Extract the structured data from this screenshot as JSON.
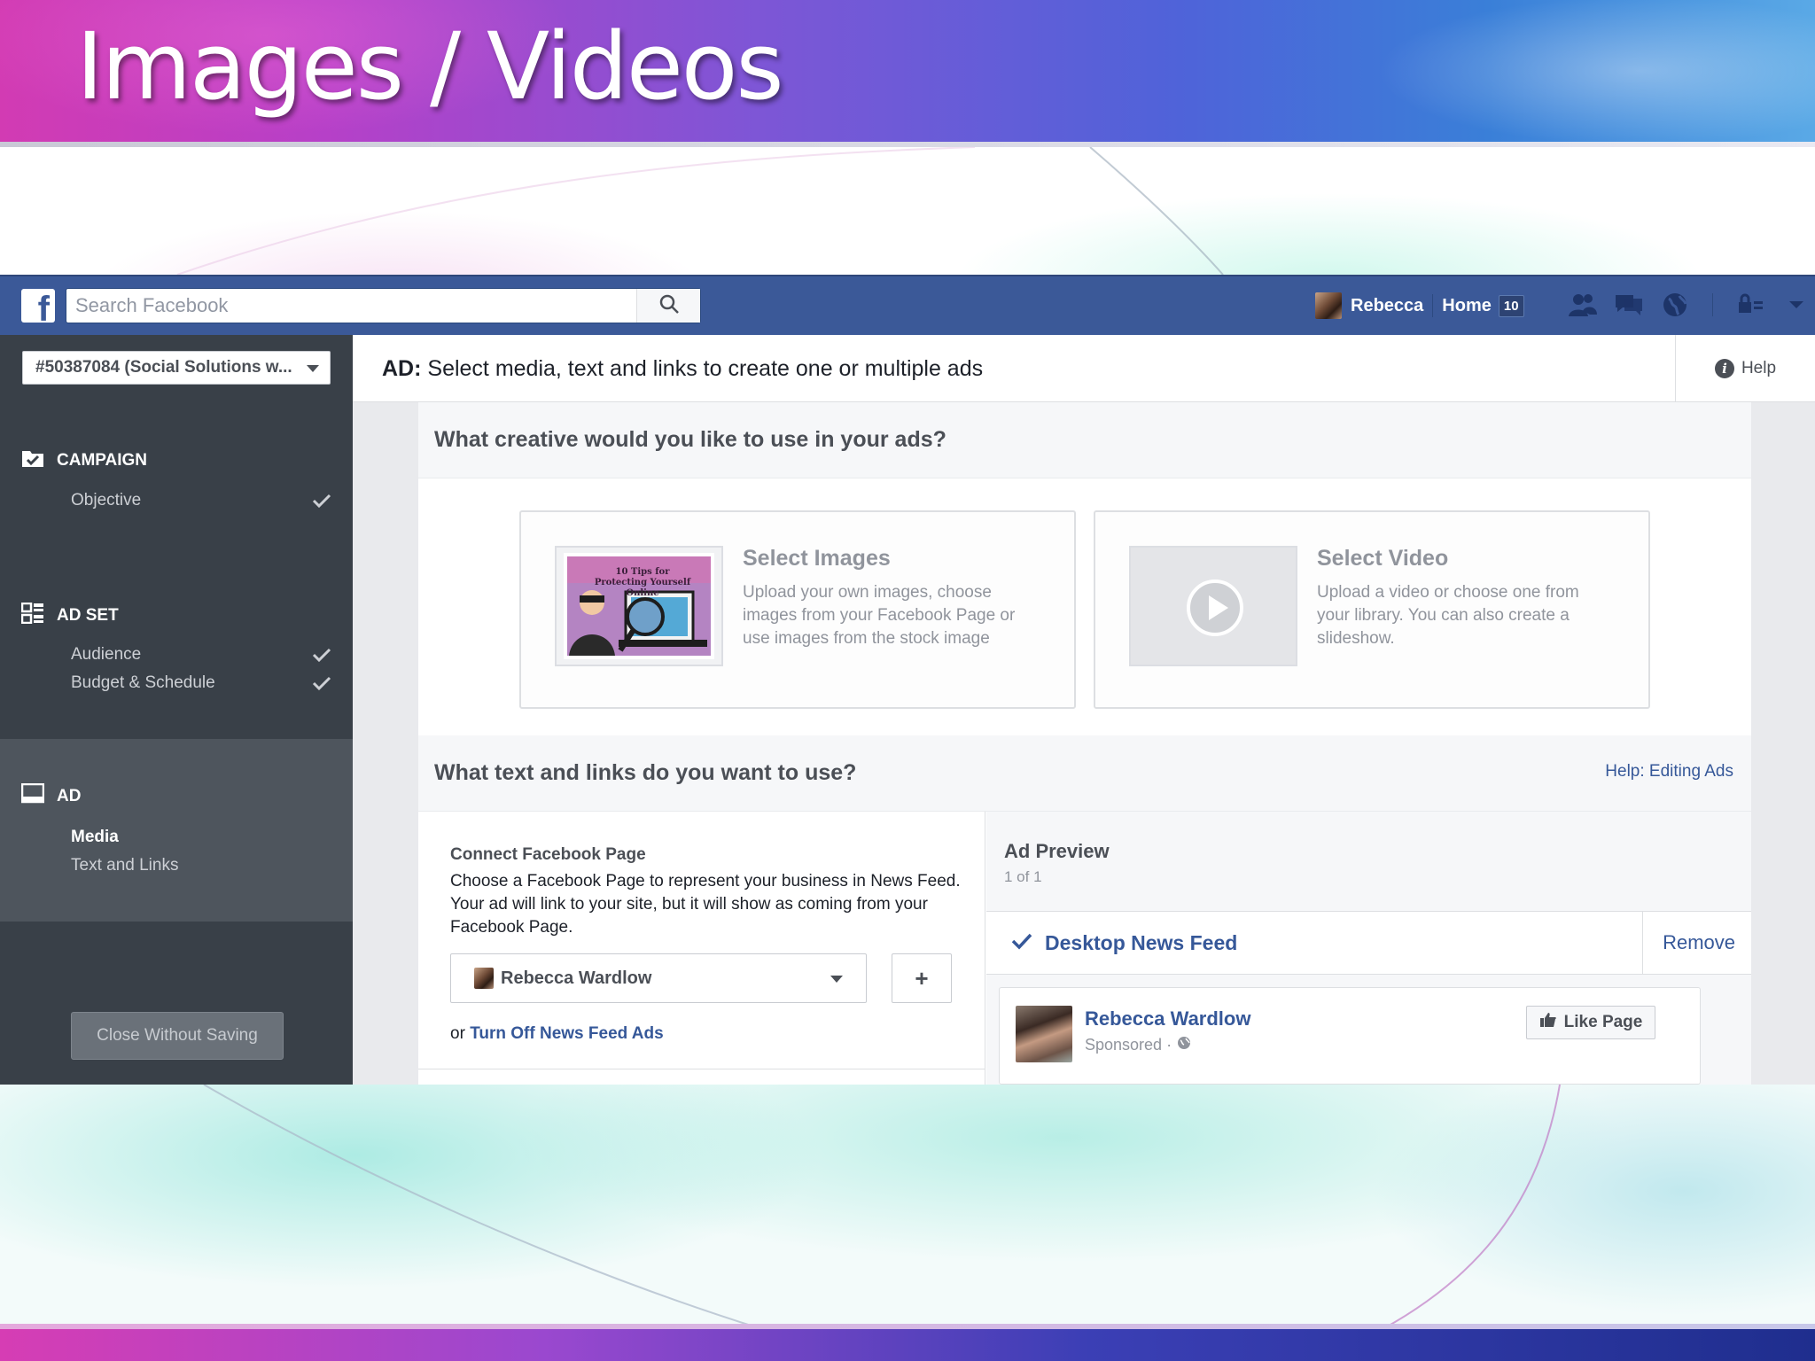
{
  "slide": {
    "title": "Images / Videos"
  },
  "topbar": {
    "search_placeholder": "Search Facebook",
    "user_name": "Rebecca",
    "home_label": "Home",
    "home_badge": "10"
  },
  "sidebar": {
    "account_select": "#50387084 (Social Solutions w...",
    "sections": {
      "campaign": {
        "label": "CAMPAIGN",
        "items": [
          {
            "label": "Objective",
            "done": true
          }
        ]
      },
      "ad_set": {
        "label": "AD SET",
        "items": [
          {
            "label": "Audience",
            "done": true
          },
          {
            "label": "Budget & Schedule",
            "done": true
          }
        ]
      },
      "ad": {
        "label": "AD",
        "items": [
          {
            "label": "Media",
            "active": true
          },
          {
            "label": "Text and Links",
            "active": false
          }
        ]
      }
    },
    "close_button": "Close Without Saving"
  },
  "header": {
    "prefix": "AD:",
    "title": "Select media, text and links to create one or multiple ads",
    "help": "Help"
  },
  "creative": {
    "heading": "What creative would you like to use in your ads?",
    "images_card": {
      "title": "Select Images",
      "description": "Upload your own images, choose images from your Facebook Page or use images from the stock image",
      "thumb_caption": "10 Tips for Protecting Yourself Online"
    },
    "video_card": {
      "title": "Select Video",
      "description": "Upload a video or choose one from your library. You can also create a slideshow."
    }
  },
  "text_links": {
    "heading": "What text and links do you want to use?",
    "help_link": "Help: Editing Ads",
    "connect_label": "Connect Facebook Page",
    "connect_desc": "Choose a Facebook Page to represent your business in News Feed. Your ad will link to your site, but it will show as coming from your Facebook Page.",
    "page_select": "Rebecca Wardlow",
    "plus_label": "+",
    "or_text": "or",
    "turn_off_link": "Turn Off News Feed Ads"
  },
  "preview": {
    "title": "Ad Preview",
    "count": "1 of 1",
    "placement": "Desktop News Feed",
    "remove": "Remove",
    "post_name": "Rebecca Wardlow",
    "sponsored": "Sponsored ·",
    "like_button": "Like Page"
  },
  "colors": {
    "fb_blue": "#3b5998",
    "link_blue": "#365899",
    "sidebar_dark": "#394048",
    "sidebar_active": "#4e555d"
  }
}
